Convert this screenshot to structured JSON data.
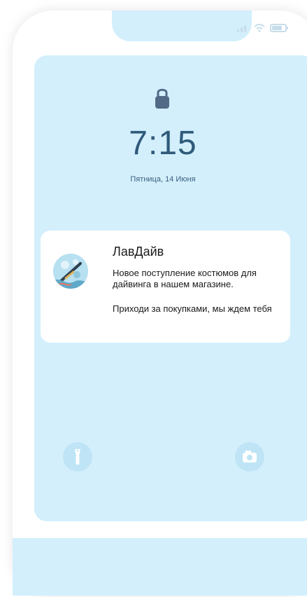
{
  "lock_screen": {
    "time": "7:15",
    "date": "Пятница, 14 Июня"
  },
  "notification": {
    "title": "ЛавДайв",
    "line1": "Новое поступление костюмов для дайвинга в нашем магазине.",
    "line2": "Приходи за покупками, мы ждем тебя"
  },
  "icons": {
    "status": [
      "signal-icon",
      "wifi-icon",
      "battery-icon"
    ],
    "lock": "lock-icon",
    "avatar": "diver-avatar",
    "left_action": "flashlight-icon",
    "right_action": "camera-icon"
  },
  "colors": {
    "background": "#d3effc",
    "phone": "#ffffff",
    "text": "#1b1b1b",
    "time": "#2f5a7a",
    "button": "#bfe4f6"
  }
}
